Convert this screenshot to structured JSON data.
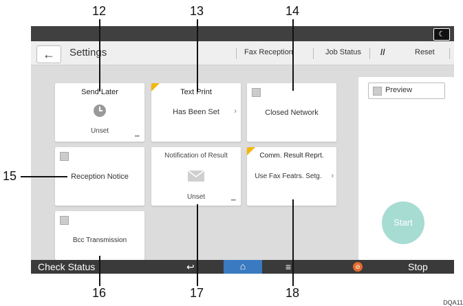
{
  "callouts": {
    "c12": "12",
    "c13": "13",
    "c14": "14",
    "c15": "15",
    "c16": "16",
    "c17": "17",
    "c18": "18"
  },
  "topbar": {
    "night_icon": "moon-icon",
    "night_glyph": "☾"
  },
  "header": {
    "back_glyph": "←",
    "title": "Settings",
    "fax_reception": "Fax Reception",
    "job_status": "Job Status",
    "reset_icon": "//",
    "reset": "Reset"
  },
  "tiles": {
    "send_later": {
      "title": "Send Later",
      "value": "Unset"
    },
    "text_print": {
      "title": "Text Print",
      "value": "Has Been Set"
    },
    "closed_network": {
      "title": "Closed Network"
    },
    "reception_notice": {
      "title": "Reception Notice"
    },
    "notification_of_result": {
      "title": "Notification of Result",
      "value": "Unset"
    },
    "comm_result_report": {
      "title": "Comm. Result Reprt.",
      "value": "Use Fax Featrs. Setg."
    },
    "bcc_transmission": {
      "title": "Bcc Transmission"
    }
  },
  "preview": {
    "label": "Preview"
  },
  "start": {
    "label": "Start"
  },
  "bottombar": {
    "check_status": "Check Status",
    "back_glyph": "↩",
    "home_glyph": "⌂",
    "menu_glyph": "≡",
    "stop": "Stop"
  },
  "figure_code": "DQA11"
}
